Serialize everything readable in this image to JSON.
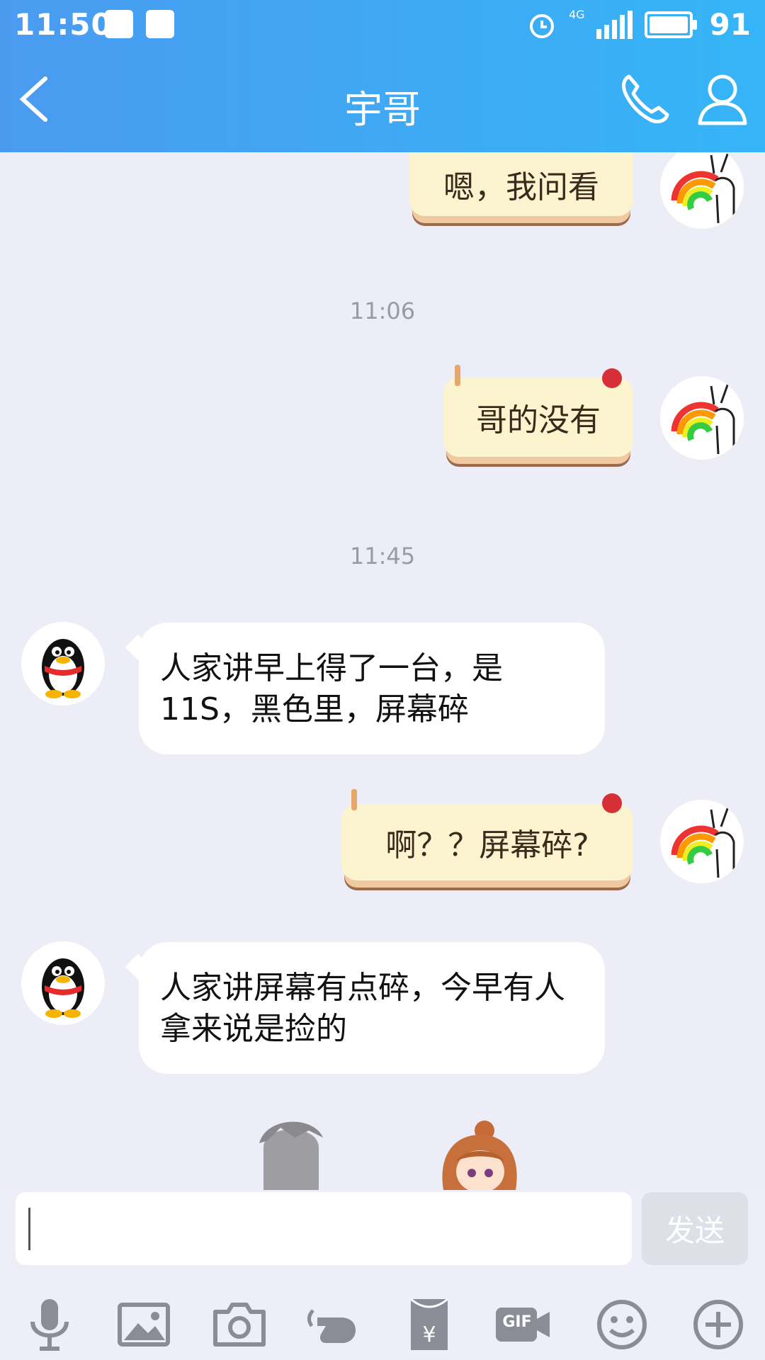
{
  "status_bar": {
    "time": "11:50",
    "signal": "4G",
    "battery": "91",
    "battery_level": 0.91
  },
  "header": {
    "title": "宇哥"
  },
  "messages": {
    "m1": {
      "text": "嗯，我问看"
    },
    "ts1": "11:06",
    "m2": {
      "text": "哥的没有"
    },
    "ts2": "11:45",
    "m3": {
      "text": "人家讲早上得了一台，是11S，黑色里，屏幕碎"
    },
    "m4": {
      "text": "啊？？屏幕碎?"
    },
    "m5": {
      "text": "人家讲屏幕有点碎，今早有人拿来说是捡的"
    }
  },
  "composer": {
    "input_value": "",
    "send_label": "发送"
  },
  "toolbar": {
    "gif_label": "GIF"
  },
  "colors": {
    "header": "#3aa8f4",
    "bubble_mine": "#fcf3cf",
    "bubble_theirs": "#ffffff",
    "background": "#ecedf6"
  }
}
